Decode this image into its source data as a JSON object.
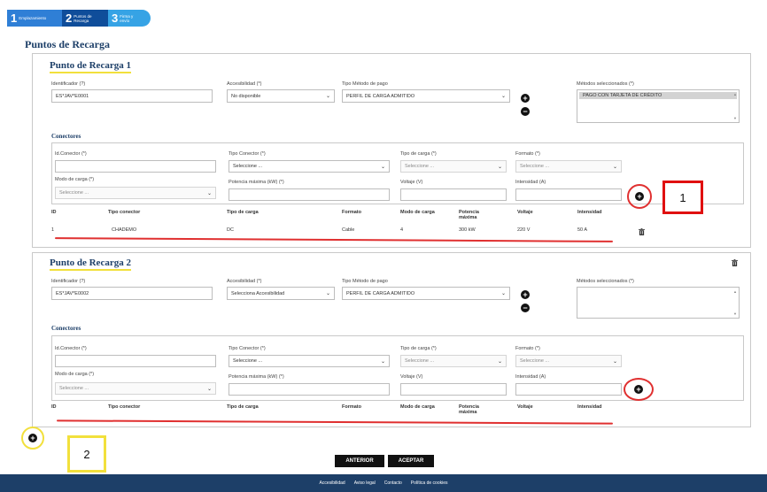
{
  "stepper": [
    {
      "num": "1",
      "label": "Emplazamiento"
    },
    {
      "num": "2",
      "label": "Puntos de\nRecarga"
    },
    {
      "num": "3",
      "label": "Firma y\nenvío"
    }
  ],
  "page_title": "Puntos de Recarga",
  "labels": {
    "identificador": "Identificador (?)",
    "accesibilidad": "Accesibilidad (*)",
    "tipo_pago_1": "Tipo Método de pago",
    "tipo_pago_2": "Tipo Método de pago",
    "metodos_sel": "Métodos seleccionados (*)",
    "conectores": "Conectores",
    "id_conector": "Id.Conector (*)",
    "tipo_conector": "Tipo Conector (*)",
    "tipo_carga": "Tipo de carga (*)",
    "formato": "Formato (*)",
    "modo_carga": "Modo de carga (*)",
    "potencia": "Potencia máxima (kW) (*)",
    "voltaje": "Voltaje (V)",
    "intensidad": "Intensidad (A)"
  },
  "placeholders": {
    "seleccione": "Seleccione ..."
  },
  "table_headers": [
    "ID",
    "Tipo conector",
    "Tipo de carga",
    "Formato",
    "Modo de carga",
    "Potencia\nmáxima",
    "Voltaje",
    "Intensidad"
  ],
  "points": [
    {
      "title": "Punto de Recarga 1",
      "identificador": "ES*JAV*E0001",
      "accesibilidad": "No disponible",
      "tipo_pago": "PERFIL DE CARGA ADMITIDO",
      "metodo_seleccionado": "PAGO CON TARJETA DE CRÉDITO",
      "tipo_conector": "Seleccione ...",
      "rows": [
        {
          "id": "1",
          "tipo_conector": "CHADEMO",
          "tipo_carga": "DC",
          "formato": "Cable",
          "modo_carga": "4",
          "potencia": "300 kW",
          "voltaje": "220 V",
          "intensidad": "50 A"
        }
      ]
    },
    {
      "title": "Punto de Recarga 2",
      "identificador": "ES*JAV*E0002",
      "accesibilidad": "Selecciona Accesibilidad",
      "tipo_pago": "PERFIL DE CARGA ADMITIDO",
      "metodo_seleccionado": "",
      "tipo_conector": "Seleccione ...",
      "rows": []
    }
  ],
  "annotations": {
    "box1": "1",
    "box2": "2"
  },
  "buttons": {
    "anterior": "ANTERIOR",
    "aceptar": "ACEPTAR"
  },
  "footer": [
    "Accesibilidad",
    "Aviso legal",
    "Contacto",
    "Política de cookies"
  ],
  "icons": {
    "add": "plus-circle-icon",
    "remove": "minus-circle-icon",
    "delete": "trash-icon"
  },
  "colors": {
    "brand": "#1d3f68",
    "annotation_red": "#e03030",
    "annotation_yellow": "#f2e03c"
  }
}
